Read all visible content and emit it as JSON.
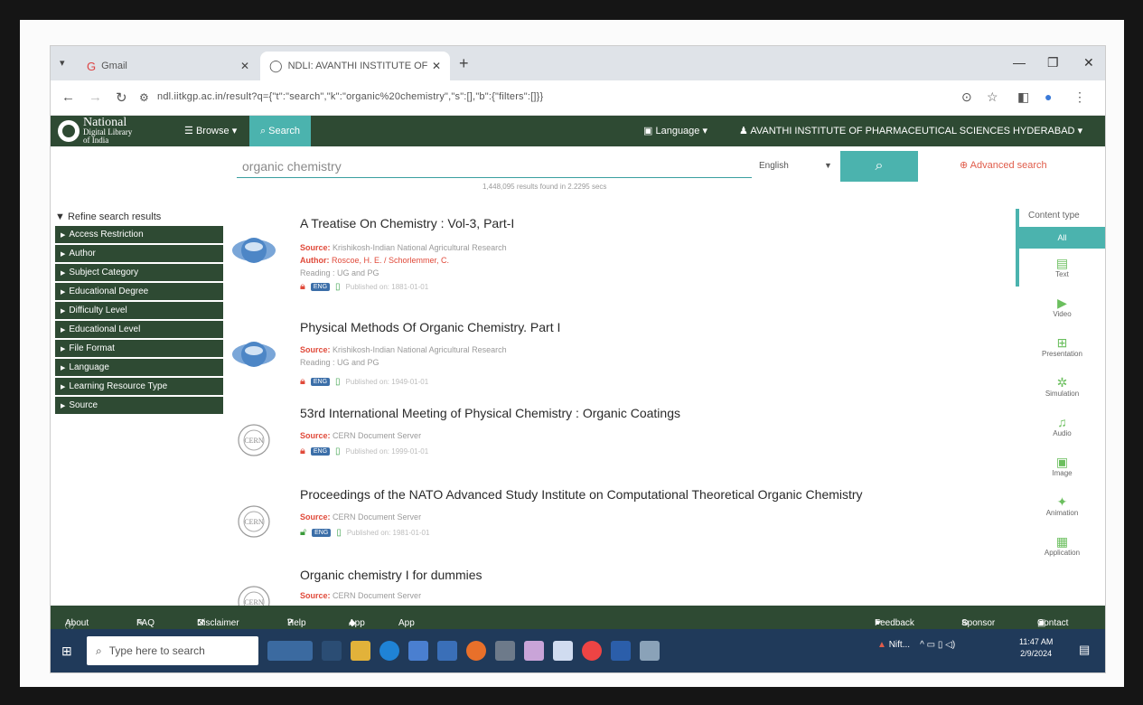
{
  "browser": {
    "tabs": [
      {
        "label": "Gmail",
        "icon": "gmail-icon"
      },
      {
        "label": "NDLI: AVANTHI INSTITUTE OF",
        "icon": "globe-icon"
      }
    ],
    "url": "ndl.iitkgp.ac.in/result?q={\"t\":\"search\",\"k\":\"organic%20chemistry\",\"s\":[],\"b\":{\"filters\":[]}}"
  },
  "site": {
    "logo": {
      "line1": "National",
      "line2": "Digital Library",
      "line3": "of India"
    },
    "browse": "Browse",
    "search": "Search",
    "language": "Language",
    "institute": "AVANTHI INSTITUTE OF PHARMACEUTICAL SCIENCES HYDERABAD"
  },
  "search": {
    "query": "organic chemistry",
    "language": "English",
    "advanced": "Advanced search",
    "result_count": "1,448,095 results found in 2.2295 secs"
  },
  "filters": {
    "title": "Refine search results",
    "items": [
      "Access Restriction",
      "Author",
      "Subject Category",
      "Educational Degree",
      "Difficulty Level",
      "Educational Level",
      "File Format",
      "Language",
      "Learning Resource Type",
      "Source"
    ]
  },
  "results": [
    {
      "title": "A Treatise On Chemistry : Vol-3, Part-I",
      "source_label": "Source:",
      "source": "Krishikosh-Indian National Agricultural Research",
      "author_label": "Author:",
      "author": "Roscoe, H. E. / Schorlemmer, C.",
      "reading": "Reading : UG and PG",
      "lang": "ENG",
      "published": "Published on: 1881-01-01",
      "access": "restricted"
    },
    {
      "title": "Physical Methods Of Organic Chemistry. Part I",
      "source_label": "Source:",
      "source": "Krishikosh-Indian National Agricultural Research",
      "reading": "Reading : UG and PG",
      "lang": "ENG",
      "published": "Published on: 1949-01-01",
      "access": "restricted"
    },
    {
      "title": "53rd International Meeting of Physical Chemistry : Organic Coatings",
      "source_label": "Source:",
      "source": "CERN Document Server",
      "lang": "ENG",
      "published": "Published on: 1999-01-01",
      "access": "restricted"
    },
    {
      "title": "Proceedings of the NATO Advanced Study Institute on Computational Theoretical Organic Chemistry",
      "source_label": "Source:",
      "source": "CERN Document Server",
      "lang": "ENG",
      "published": "Published on: 1981-01-01",
      "access": "open"
    },
    {
      "title": "Organic chemistry I for dummies",
      "source_label": "Source:",
      "source": "CERN Document Server"
    }
  ],
  "content_type": {
    "title": "Content type",
    "all": "All",
    "items": [
      {
        "label": "Text",
        "icon": "text-icon"
      },
      {
        "label": "Video",
        "icon": "video-icon"
      },
      {
        "label": "Presentation",
        "icon": "presentation-icon"
      },
      {
        "label": "Simulation",
        "icon": "simulation-icon"
      },
      {
        "label": "Audio",
        "icon": "audio-icon"
      },
      {
        "label": "Image",
        "icon": "image-icon"
      },
      {
        "label": "Animation",
        "icon": "animation-icon"
      },
      {
        "label": "Application",
        "icon": "application-icon"
      }
    ]
  },
  "footer": {
    "about": "About",
    "faq": "FAQ",
    "disclaimer": "Disclaimer",
    "help": "Help",
    "app1": "App",
    "app2": "App",
    "feedback": "Feedback",
    "sponsor": "Sponsor",
    "contact": "Contact"
  },
  "taskbar": {
    "search_placeholder": "Type here to search",
    "tray_label": "Nift...",
    "time": "11:47 AM",
    "date": "2/9/2024"
  },
  "colors": {
    "header_green": "#2e4a33",
    "teal": "#4bb3ae",
    "accent_red": "#e04a3a"
  }
}
